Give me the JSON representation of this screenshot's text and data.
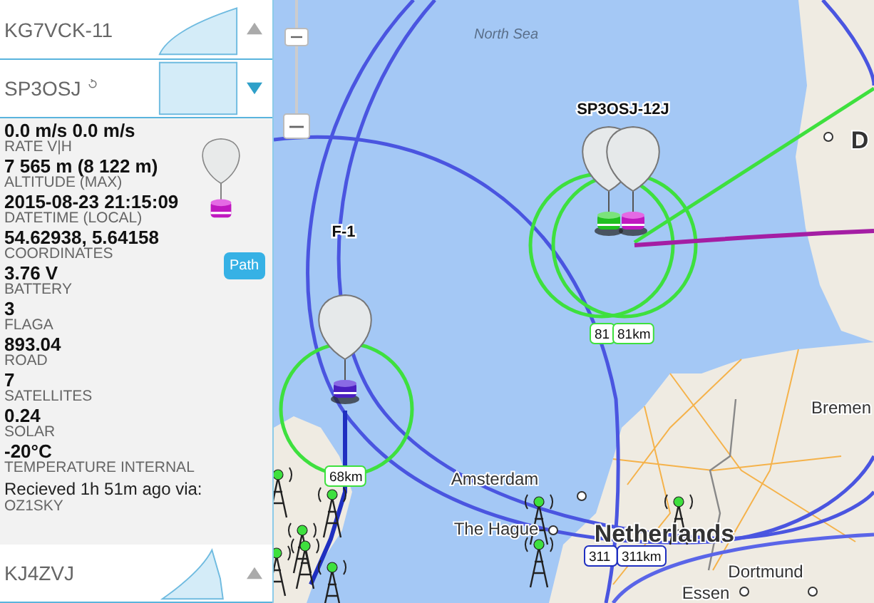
{
  "sidebar": {
    "items": [
      {
        "callsign": "KG7VCK-11",
        "expanded": false,
        "refresh_icon": false
      },
      {
        "callsign": "SP3OSJ",
        "expanded": true,
        "refresh_icon": true
      },
      {
        "callsign": "KJ4ZVJ",
        "expanded": false,
        "refresh_icon": false
      }
    ],
    "details": {
      "fields": [
        {
          "value": "0.0 m/s 0.0 m/s",
          "label": "RATE V|H"
        },
        {
          "value": "7 565 m (8 122 m)",
          "label": "ALTITUDE (MAX)"
        },
        {
          "value": "2015-08-23 21:15:09",
          "label": "DATETIME (LOCAL)"
        },
        {
          "value": "54.62938, 5.64158",
          "label": "COORDINATES"
        },
        {
          "value": "3.76 V",
          "label": "BATTERY"
        },
        {
          "value": "3",
          "label": "FLAGA"
        },
        {
          "value": "893.04",
          "label": "ROAD"
        },
        {
          "value": "7",
          "label": "SATELLITES"
        },
        {
          "value": "0.24",
          "label": "SOLAR"
        },
        {
          "value": "-20°C",
          "label": "TEMPERATURE INTERNAL"
        }
      ],
      "path_button": "Path",
      "received": "Recieved 1h 51m ago via:",
      "via": "OZ1SKY"
    }
  },
  "map": {
    "labels": [
      {
        "kind": "sea",
        "text": "North Sea"
      },
      {
        "kind": "marker",
        "text": "SP3OSJ-12J"
      },
      {
        "kind": "marker",
        "text": "F-1"
      },
      {
        "kind": "distance",
        "text": "81"
      },
      {
        "kind": "distance",
        "text": "81km"
      },
      {
        "kind": "distance",
        "text": "68km"
      },
      {
        "kind": "city",
        "text": "Amsterdam"
      },
      {
        "kind": "city",
        "text": "The Hague"
      },
      {
        "kind": "country",
        "text": "Netherlands"
      },
      {
        "kind": "distance",
        "text": "311"
      },
      {
        "kind": "distance",
        "text": "311km"
      },
      {
        "kind": "city",
        "text": "Bremen"
      },
      {
        "kind": "city",
        "text": "Dortmund"
      },
      {
        "kind": "city",
        "text": "Essen"
      },
      {
        "kind": "country",
        "text": "D"
      }
    ]
  }
}
